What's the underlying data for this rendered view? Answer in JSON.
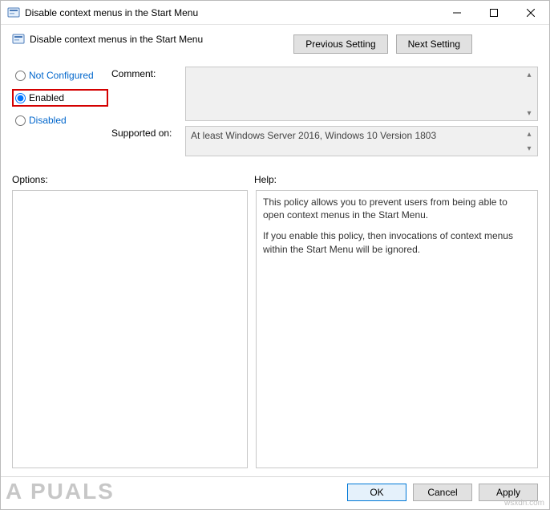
{
  "titlebar": {
    "title": "Disable context menus in the Start Menu"
  },
  "header": {
    "policy_title": "Disable context menus in the Start Menu",
    "prev_btn": "Previous Setting",
    "next_btn": "Next Setting"
  },
  "radios": {
    "not_configured": "Not Configured",
    "enabled": "Enabled",
    "disabled": "Disabled",
    "selected": "enabled"
  },
  "fields": {
    "comment_label": "Comment:",
    "comment_value": "",
    "supported_label": "Supported on:",
    "supported_value": "At least Windows Server 2016, Windows 10 Version 1803"
  },
  "labels": {
    "options": "Options:",
    "help": "Help:"
  },
  "help": {
    "p1": "This policy allows you to prevent users from being able to open context menus in the Start Menu.",
    "p2": "If you enable this policy, then invocations of context menus within the Start Menu will be ignored."
  },
  "footer": {
    "ok": "OK",
    "cancel": "Cancel",
    "apply": "Apply"
  },
  "watermark": {
    "brand": "A  PUALS",
    "credit": "wsxdn.com"
  }
}
